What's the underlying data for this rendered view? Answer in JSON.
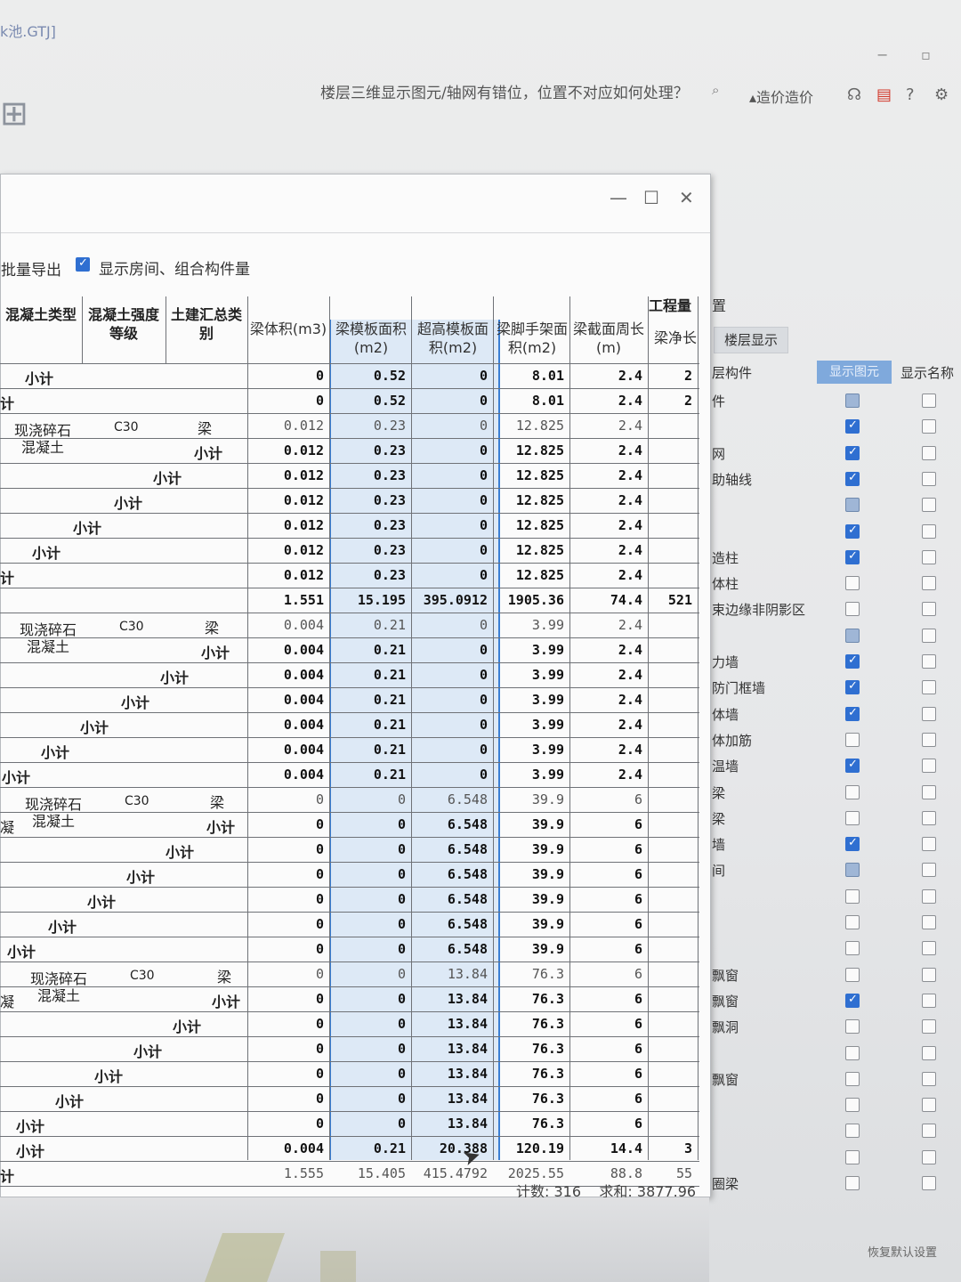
{
  "app": {
    "title_fragment": "k池.GTJ]",
    "help_question": "楼层三维显示图元/轴网有错位，位置不对应如何处理？",
    "price_link": "造价造价"
  },
  "dialog": {
    "export_button": "批量导出",
    "show_checkbox_label": "显示房间、组合构件量",
    "show_checked": true,
    "headers": {
      "concrete_type": "混凝土类型",
      "concrete_grade": "混凝土强度等级",
      "summary_category": "土建汇总类别",
      "group_title": "工程量",
      "beam_volume": "梁体积(m3)",
      "beam_form_area": "梁模板面积(m2)",
      "high_form_area": "超高模板面积(m2)",
      "scaffold_area": "梁脚手架面积(m2)",
      "section_perimeter": "梁截面周长(m)",
      "net_length": "梁净长"
    },
    "labels": {
      "subtotal": "小计",
      "total_fragment": "计",
      "cast_in_place": "现浇碎石混凝土",
      "grade": "C30",
      "beam": "梁",
      "cut_frag": "凝"
    },
    "rows": [
      {
        "v": "0",
        "a": "0.52",
        "h": "0",
        "s": "8.01",
        "p": "2.4",
        "n": "2"
      },
      {
        "v": "0",
        "a": "0.52",
        "h": "0",
        "s": "8.01",
        "p": "2.4",
        "n": "2"
      },
      {
        "v": "0.012",
        "a": "0.23",
        "h": "0",
        "s": "12.825",
        "p": "2.4",
        "n": ""
      },
      {
        "v": "0.012",
        "a": "0.23",
        "h": "0",
        "s": "12.825",
        "p": "2.4",
        "n": ""
      },
      {
        "v": "0.012",
        "a": "0.23",
        "h": "0",
        "s": "12.825",
        "p": "2.4",
        "n": ""
      },
      {
        "v": "0.012",
        "a": "0.23",
        "h": "0",
        "s": "12.825",
        "p": "2.4",
        "n": ""
      },
      {
        "v": "0.012",
        "a": "0.23",
        "h": "0",
        "s": "12.825",
        "p": "2.4",
        "n": ""
      },
      {
        "v": "0.012",
        "a": "0.23",
        "h": "0",
        "s": "12.825",
        "p": "2.4",
        "n": ""
      },
      {
        "v": "0.012",
        "a": "0.23",
        "h": "0",
        "s": "12.825",
        "p": "2.4",
        "n": ""
      },
      {
        "v": "1.551",
        "a": "15.195",
        "h": "395.0912",
        "s": "1905.36",
        "p": "74.4",
        "n": "521"
      },
      {
        "v": "0.004",
        "a": "0.21",
        "h": "0",
        "s": "3.99",
        "p": "2.4",
        "n": ""
      },
      {
        "v": "0.004",
        "a": "0.21",
        "h": "0",
        "s": "3.99",
        "p": "2.4",
        "n": ""
      },
      {
        "v": "0.004",
        "a": "0.21",
        "h": "0",
        "s": "3.99",
        "p": "2.4",
        "n": ""
      },
      {
        "v": "0.004",
        "a": "0.21",
        "h": "0",
        "s": "3.99",
        "p": "2.4",
        "n": ""
      },
      {
        "v": "0.004",
        "a": "0.21",
        "h": "0",
        "s": "3.99",
        "p": "2.4",
        "n": ""
      },
      {
        "v": "0.004",
        "a": "0.21",
        "h": "0",
        "s": "3.99",
        "p": "2.4",
        "n": ""
      },
      {
        "v": "0.004",
        "a": "0.21",
        "h": "0",
        "s": "3.99",
        "p": "2.4",
        "n": ""
      },
      {
        "v": "0",
        "a": "0",
        "h": "6.548",
        "s": "39.9",
        "p": "6",
        "n": ""
      },
      {
        "v": "0",
        "a": "0",
        "h": "6.548",
        "s": "39.9",
        "p": "6",
        "n": ""
      },
      {
        "v": "0",
        "a": "0",
        "h": "6.548",
        "s": "39.9",
        "p": "6",
        "n": ""
      },
      {
        "v": "0",
        "a": "0",
        "h": "6.548",
        "s": "39.9",
        "p": "6",
        "n": ""
      },
      {
        "v": "0",
        "a": "0",
        "h": "6.548",
        "s": "39.9",
        "p": "6",
        "n": ""
      },
      {
        "v": "0",
        "a": "0",
        "h": "6.548",
        "s": "39.9",
        "p": "6",
        "n": ""
      },
      {
        "v": "0",
        "a": "0",
        "h": "6.548",
        "s": "39.9",
        "p": "6",
        "n": ""
      },
      {
        "v": "0",
        "a": "0",
        "h": "13.84",
        "s": "76.3",
        "p": "6",
        "n": ""
      },
      {
        "v": "0",
        "a": "0",
        "h": "13.84",
        "s": "76.3",
        "p": "6",
        "n": ""
      },
      {
        "v": "0",
        "a": "0",
        "h": "13.84",
        "s": "76.3",
        "p": "6",
        "n": ""
      },
      {
        "v": "0",
        "a": "0",
        "h": "13.84",
        "s": "76.3",
        "p": "6",
        "n": ""
      },
      {
        "v": "0",
        "a": "0",
        "h": "13.84",
        "s": "76.3",
        "p": "6",
        "n": ""
      },
      {
        "v": "0",
        "a": "0",
        "h": "13.84",
        "s": "76.3",
        "p": "6",
        "n": ""
      },
      {
        "v": "0",
        "a": "0",
        "h": "13.84",
        "s": "76.3",
        "p": "6",
        "n": ""
      },
      {
        "v": "0.004",
        "a": "0.21",
        "h": "20.388",
        "s": "120.19",
        "p": "14.4",
        "n": "3"
      },
      {
        "v": "1.555",
        "a": "15.405",
        "h": "415.4792",
        "s": "2025.55",
        "p": "88.8",
        "n": "55"
      }
    ],
    "status": {
      "count_label": "计数:",
      "count": "316",
      "sum_label": "求和:",
      "sum": "3877.96"
    }
  },
  "right_panel": {
    "title": "置",
    "tab_floor_display": "楼层显示",
    "col_layer_component": "层构件",
    "col_show_element": "显示图元",
    "col_show_name": "显示名称",
    "rows": [
      {
        "label": "件",
        "show": "part",
        "name": false
      },
      {
        "label": "",
        "show": "on",
        "name": false
      },
      {
        "label": "网",
        "show": "on",
        "name": false
      },
      {
        "label": "助轴线",
        "show": "on",
        "name": false
      },
      {
        "label": "",
        "show": "part",
        "name": false
      },
      {
        "label": "",
        "show": "on",
        "name": false
      },
      {
        "label": "造柱",
        "show": "on",
        "name": false
      },
      {
        "label": "体柱",
        "show": "off",
        "name": false
      },
      {
        "label": "束边缘非阴影区",
        "show": "off",
        "name": false
      },
      {
        "label": "",
        "show": "part",
        "name": false
      },
      {
        "label": "力墙",
        "show": "on",
        "name": false
      },
      {
        "label": "防门框墙",
        "show": "on",
        "name": false
      },
      {
        "label": "体墙",
        "show": "on",
        "name": false
      },
      {
        "label": "体加筋",
        "show": "off",
        "name": false
      },
      {
        "label": "温墙",
        "show": "on",
        "name": false
      },
      {
        "label": "梁",
        "show": "off",
        "name": false
      },
      {
        "label": "梁",
        "show": "off",
        "name": false
      },
      {
        "label": "墙",
        "show": "on",
        "name": false
      },
      {
        "label": "间",
        "show": "part",
        "name": false
      },
      {
        "label": "",
        "show": "off",
        "name": false
      },
      {
        "label": "",
        "show": "off",
        "name": false
      },
      {
        "label": "",
        "show": "off",
        "name": false
      },
      {
        "label": "飘窗",
        "show": "off",
        "name": false
      },
      {
        "label": "飘窗",
        "show": "on",
        "name": false
      },
      {
        "label": "飘洞",
        "show": "off",
        "name": false
      },
      {
        "label": "",
        "show": "off",
        "name": false
      },
      {
        "label": "飘窗",
        "show": "off",
        "name": false
      },
      {
        "label": "",
        "show": "off",
        "name": false
      },
      {
        "label": "",
        "show": "off",
        "name": false
      },
      {
        "label": "",
        "show": "off",
        "name": false
      },
      {
        "label": "圈梁",
        "show": "off",
        "name": false
      }
    ],
    "restore_default": "恢复默认设置"
  }
}
